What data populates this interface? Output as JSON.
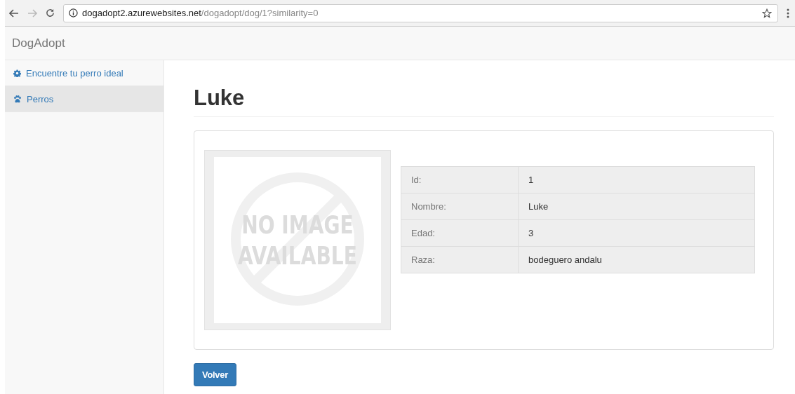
{
  "browser": {
    "url_host": "dogadopt2.azurewebsites.net",
    "url_path": "/dogadopt/dog/1?similarity=0"
  },
  "navbar": {
    "brand": "DogAdopt"
  },
  "sidebar": {
    "items": [
      {
        "label": "Encuentre tu perro ideal",
        "selected": false
      },
      {
        "label": "Perros",
        "selected": true
      }
    ]
  },
  "page": {
    "title": "Luke",
    "image": {
      "lines": [
        "NO IMAGE",
        "AVAILABLE"
      ]
    },
    "details": [
      {
        "label": "Id:",
        "value": "1"
      },
      {
        "label": "Nombre:",
        "value": "Luke"
      },
      {
        "label": "Edad:",
        "value": "3"
      },
      {
        "label": "Raza:",
        "value": "bodeguero andalu"
      }
    ],
    "back_button": "Volver"
  }
}
